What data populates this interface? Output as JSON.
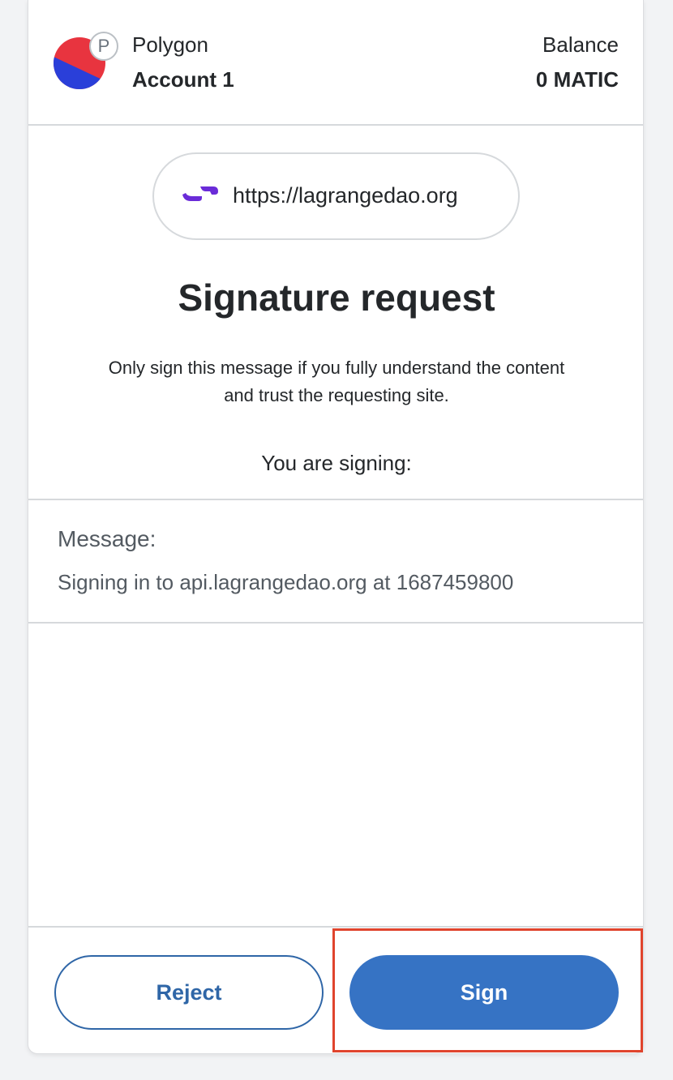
{
  "header": {
    "network_name": "Polygon",
    "network_badge": "P",
    "account_name": "Account 1",
    "balance_label": "Balance",
    "balance_value": "0 MATIC",
    "avatar_colors": {
      "top": "#e8343f",
      "bottom": "#2a3fd9"
    }
  },
  "origin": {
    "url": "https://lagrangedao.org",
    "icon_color": "#6a2bd8"
  },
  "request": {
    "title": "Signature request",
    "subtitle": "Only sign this message if you fully understand the content and trust the requesting site.",
    "signing_label": "You are signing:"
  },
  "message": {
    "label": "Message:",
    "content": "Signing in to api.lagrangedao.org at 1687459800"
  },
  "footer": {
    "reject_label": "Reject",
    "sign_label": "Sign",
    "highlight_color": "#e0442d"
  },
  "colors": {
    "primary": "#3673c4",
    "border": "#d6d9dc",
    "text": "#24272a"
  }
}
